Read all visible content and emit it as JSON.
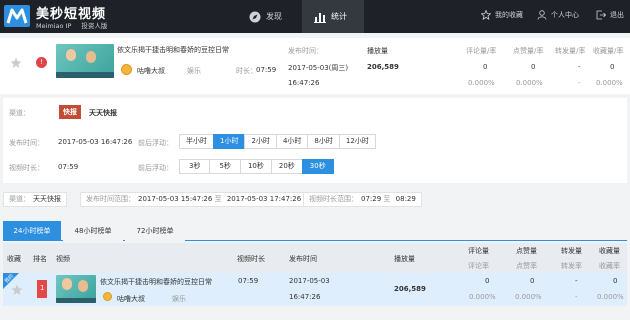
{
  "app": {
    "logo_cn": "美秒短视频",
    "logo_sub": "Meimiao IP",
    "logo_sub2": "投资人版"
  },
  "nav": [
    {
      "label": "发现",
      "icon": "compass-icon",
      "active": false
    },
    {
      "label": "统计",
      "icon": "bar-chart-icon",
      "active": true
    }
  ],
  "top_right": {
    "favorites": "我的收藏",
    "profile": "个人中心",
    "logout": "退出"
  },
  "video": {
    "title": "依文乐揭干捷击明和春娇的豆控日常",
    "author": "咕噜大叔",
    "category": "娱乐",
    "duration_label": "时长：",
    "duration": "07:59",
    "publish_label": "发布时间：",
    "publish_date": "2017-05-03(周三)",
    "publish_time": "16:47:26",
    "badge": "!",
    "plays_label": "播放量",
    "plays": "206,589",
    "metrics": [
      {
        "label": "评论量/率",
        "value": "0",
        "rate": "0.000%"
      },
      {
        "label": "点赞量/率",
        "value": "0",
        "rate": "0.000%"
      },
      {
        "label": "转发量/率",
        "value": "-",
        "rate": "-"
      },
      {
        "label": "收藏量/率",
        "value": "0",
        "rate": "0.000%"
      }
    ]
  },
  "filters": {
    "channel_label": "渠道：",
    "channel_icon": "快报",
    "channel_name": "天天快报",
    "pubtime_label": "发布时间：",
    "pubtime": "2017-05-03 16:47:26",
    "pubfloat_label": "前后浮动：",
    "pub_options": [
      "半小时",
      "1小时",
      "2小时",
      "4小时",
      "8小时",
      "12小时"
    ],
    "pub_selected": 1,
    "duration_label": "视频时长：",
    "duration": "07:59",
    "durfloat_label": "前后浮动：",
    "dur_options": [
      "3秒",
      "5秒",
      "10秒",
      "20秒",
      "30秒"
    ],
    "dur_selected": 4
  },
  "summary": {
    "channel_label": "渠道：",
    "channel": "天天快报",
    "range_label": "发布时间范围：",
    "range_start": "2017-05-03 15:47:26",
    "range_to": "至",
    "range_end": "2017-05-03 17:47:26",
    "dur_label": "视频时长范围：",
    "dur_start": "07:29",
    "dur_to": "至",
    "dur_end": "08:29"
  },
  "rank_tabs": [
    "24小时榜单",
    "48小时榜单",
    "72小时榜单"
  ],
  "rank_tab_selected": 0,
  "table": {
    "headers": {
      "fav": "收藏",
      "rank": "排名",
      "video": "视频",
      "dur": "视频时长",
      "pub": "发布时间",
      "plays": "播放量",
      "comments": "评论量",
      "comments_rate": "评论率",
      "likes": "点赞量",
      "likes_rate": "点赞率",
      "shares": "转发量",
      "shares_rate": "转发率",
      "favs": "收藏量",
      "favs_rate": "收藏率"
    },
    "rows": [
      {
        "rank": "1",
        "title": "依文乐揭干捷击明和春娇的豆控日常",
        "author": "咕噜大叔",
        "category": "娱乐",
        "dur": "07:59",
        "pub_date": "2017-05-03",
        "pub_time": "16:47:26",
        "plays": "206,589",
        "comments": "0",
        "comments_rate": "0.000%",
        "likes": "0",
        "likes_rate": "0.000%",
        "shares": "-",
        "shares_rate": "-",
        "favs": "0",
        "favs_rate": "0.000%",
        "corner": "我的"
      }
    ]
  }
}
